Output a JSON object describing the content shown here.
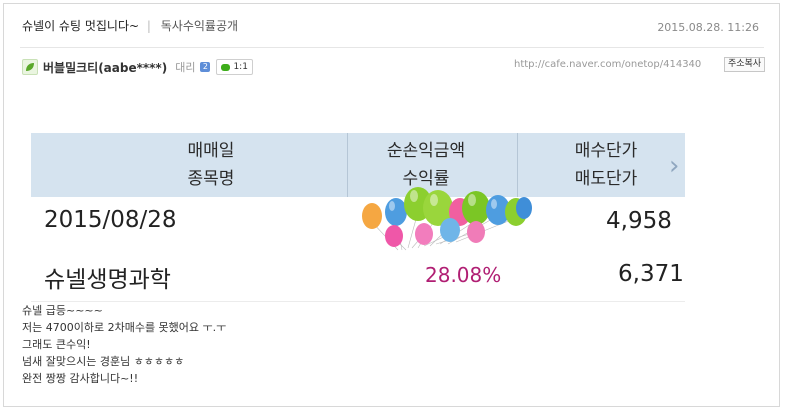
{
  "post": {
    "title": "슈넬이 슈팅 멋집니다~",
    "separator": "|",
    "category": "독사수익률공개",
    "date": "2015.08.28. 11:26"
  },
  "author": {
    "name": "버블밀크티(aabe****)",
    "rank": "대리",
    "chat_label": "1:1",
    "url": "http://cafe.naver.com/onetop/414340",
    "copy_label": "주소복사"
  },
  "trade_card": {
    "header": {
      "col1_line1": "매매일",
      "col1_line2": "종목명",
      "col2_line1": "순손익금액",
      "col2_line2": "수익률",
      "col3_line1": "매수단가",
      "col3_line2": "매도단가",
      "chevron": "›"
    },
    "trade_date": "2015/08/28",
    "buy_price": "4,958",
    "stock_name": "슈넬생명과학",
    "return_rate": "28.08%",
    "sell_price": "6,371"
  },
  "body_lines": [
    "슈넬 급등~~~~",
    "저는 4700이하로 2차매수를 못했어요 ㅜ.ㅜ",
    "그래도 큰수익!",
    "넘새 잘맞으시는 경훈님 ㅎㅎㅎㅎㅎ",
    "완전 짱짱 감사합니다~!!"
  ],
  "colors": {
    "header_bg": "#d5e3ef",
    "return_rate": "#b01e73",
    "chat_icon": "#3dad1a"
  },
  "icons": [
    "leaf-icon",
    "rank-icon",
    "chat-icon",
    "chevron-right-icon",
    "balloons-sticker"
  ]
}
